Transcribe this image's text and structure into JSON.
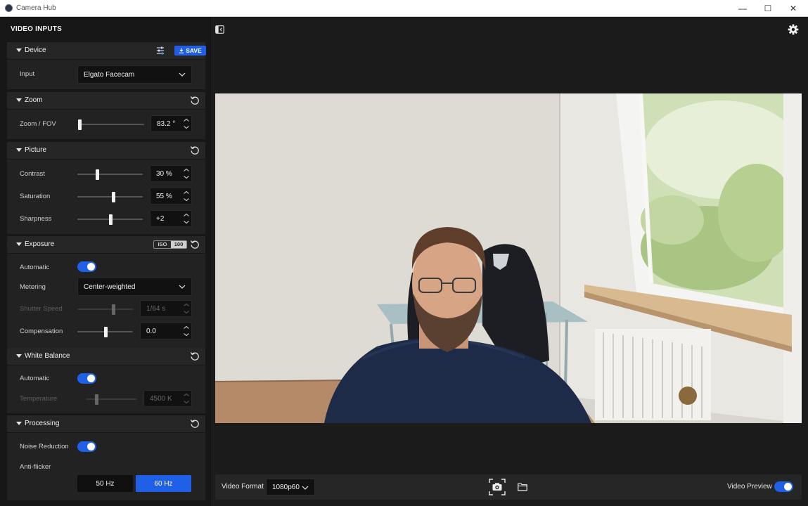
{
  "window": {
    "title": "Camera Hub",
    "controls": {
      "minimize": "—",
      "maximize": "☐",
      "close": "✕"
    }
  },
  "panel": {
    "title": "VIDEO INPUTS",
    "device": {
      "title": "Device",
      "save_label": "SAVE",
      "input_label": "Input",
      "input_value": "Elgato Facecam"
    },
    "zoom": {
      "title": "Zoom",
      "fov_label": "Zoom / FOV",
      "fov_value": "83.2 °",
      "fov_fraction": 0.03
    },
    "picture": {
      "title": "Picture",
      "contrast_label": "Contrast",
      "contrast_value": "30 %",
      "contrast_fraction": 0.3,
      "saturation_label": "Saturation",
      "saturation_value": "55 %",
      "saturation_fraction": 0.55,
      "sharpness_label": "Sharpness",
      "sharpness_value": "+2",
      "sharpness_fraction": 0.5
    },
    "exposure": {
      "title": "Exposure",
      "iso_label": "ISO",
      "iso_value": "100",
      "automatic_label": "Automatic",
      "automatic_on": true,
      "metering_label": "Metering",
      "metering_value": "Center-weighted",
      "shutter_label": "Shutter Speed",
      "shutter_value": "1/64 s",
      "shutter_fraction": 0.65,
      "compensation_label": "Compensation",
      "compensation_value": "0.0",
      "compensation_fraction": 0.5
    },
    "white_balance": {
      "title": "White Balance",
      "automatic_label": "Automatic",
      "automatic_on": true,
      "temperature_label": "Temperature",
      "temperature_value": "4500 K",
      "temperature_fraction": 0.2
    },
    "processing": {
      "title": "Processing",
      "noise_label": "Noise Reduction",
      "noise_on": true,
      "antiflicker_label": "Anti-flicker",
      "hz_50": "50 Hz",
      "hz_60": "60 Hz",
      "selected": "60 Hz"
    }
  },
  "bottom": {
    "video_format_label": "Video Format",
    "video_format_value": "1080p60",
    "video_preview_label": "Video Preview",
    "video_preview_on": true
  },
  "colors": {
    "accent": "#2060e8",
    "panel_bg": "#171717",
    "section_bg": "#222222"
  }
}
